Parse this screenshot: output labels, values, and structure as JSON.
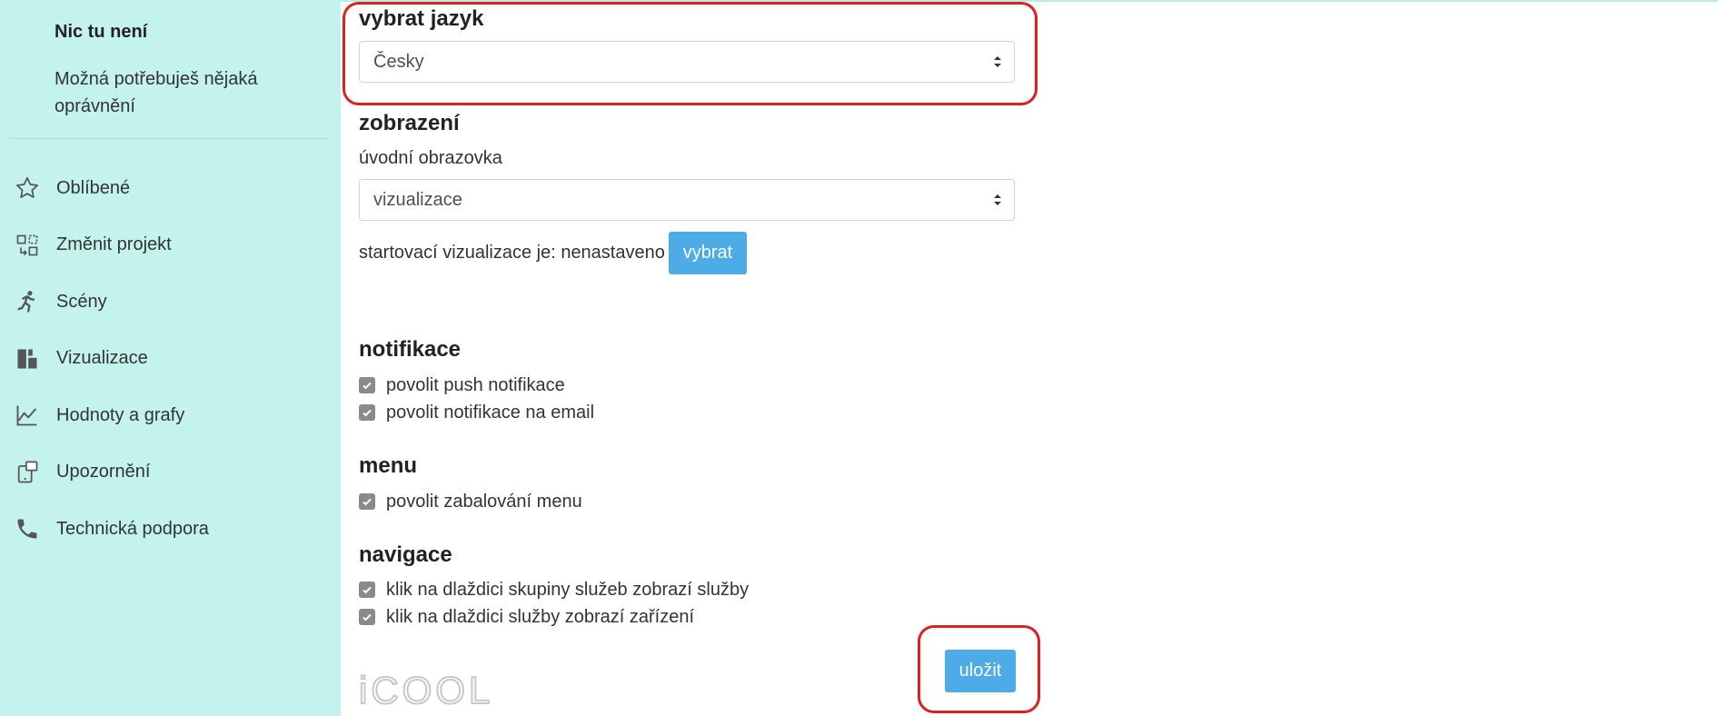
{
  "sidebar": {
    "title": "Nic tu není",
    "subtitle": "Možná potřebuješ nějaká oprávnění",
    "items": [
      {
        "label": "Oblíbené",
        "icon": "star-icon"
      },
      {
        "label": "Změnit projekt",
        "icon": "switch-project-icon"
      },
      {
        "label": "Scény",
        "icon": "running-figure-icon"
      },
      {
        "label": "Vizualizace",
        "icon": "dashboard-blocks-icon"
      },
      {
        "label": "Hodnoty a grafy",
        "icon": "line-chart-icon"
      },
      {
        "label": "Upozornění",
        "icon": "notification-icon"
      },
      {
        "label": "Technická podpora",
        "icon": "phone-icon"
      }
    ]
  },
  "language": {
    "heading": "vybrat jazyk",
    "selected": "Česky"
  },
  "display": {
    "heading": "zobrazení",
    "start_screen_label": "úvodní obrazovka",
    "start_screen_selected": "vizualizace",
    "start_viz_text": "startovací vizualizace je: nenastaveno",
    "choose_button": "vybrat"
  },
  "notifications": {
    "heading": "notifikace",
    "options": [
      {
        "label": "povolit push notifikace",
        "checked": true
      },
      {
        "label": "povolit notifikace na email",
        "checked": true
      }
    ]
  },
  "menu": {
    "heading": "menu",
    "options": [
      {
        "label": "povolit zabalování menu",
        "checked": true
      }
    ]
  },
  "navigation": {
    "heading": "navigace",
    "options": [
      {
        "label": "klik na dlaždici skupiny služeb zobrazí služby",
        "checked": true
      },
      {
        "label": "klik na dlaždici služby zobrazí zařízení",
        "checked": true
      }
    ]
  },
  "save_button": "uložit",
  "logo_text": "iCOOL",
  "colors": {
    "sidebar_bg": "#c3f3ec",
    "accent": "#4dabe6",
    "highlight": "#e02020",
    "checkbox": "#8a8a8a"
  }
}
